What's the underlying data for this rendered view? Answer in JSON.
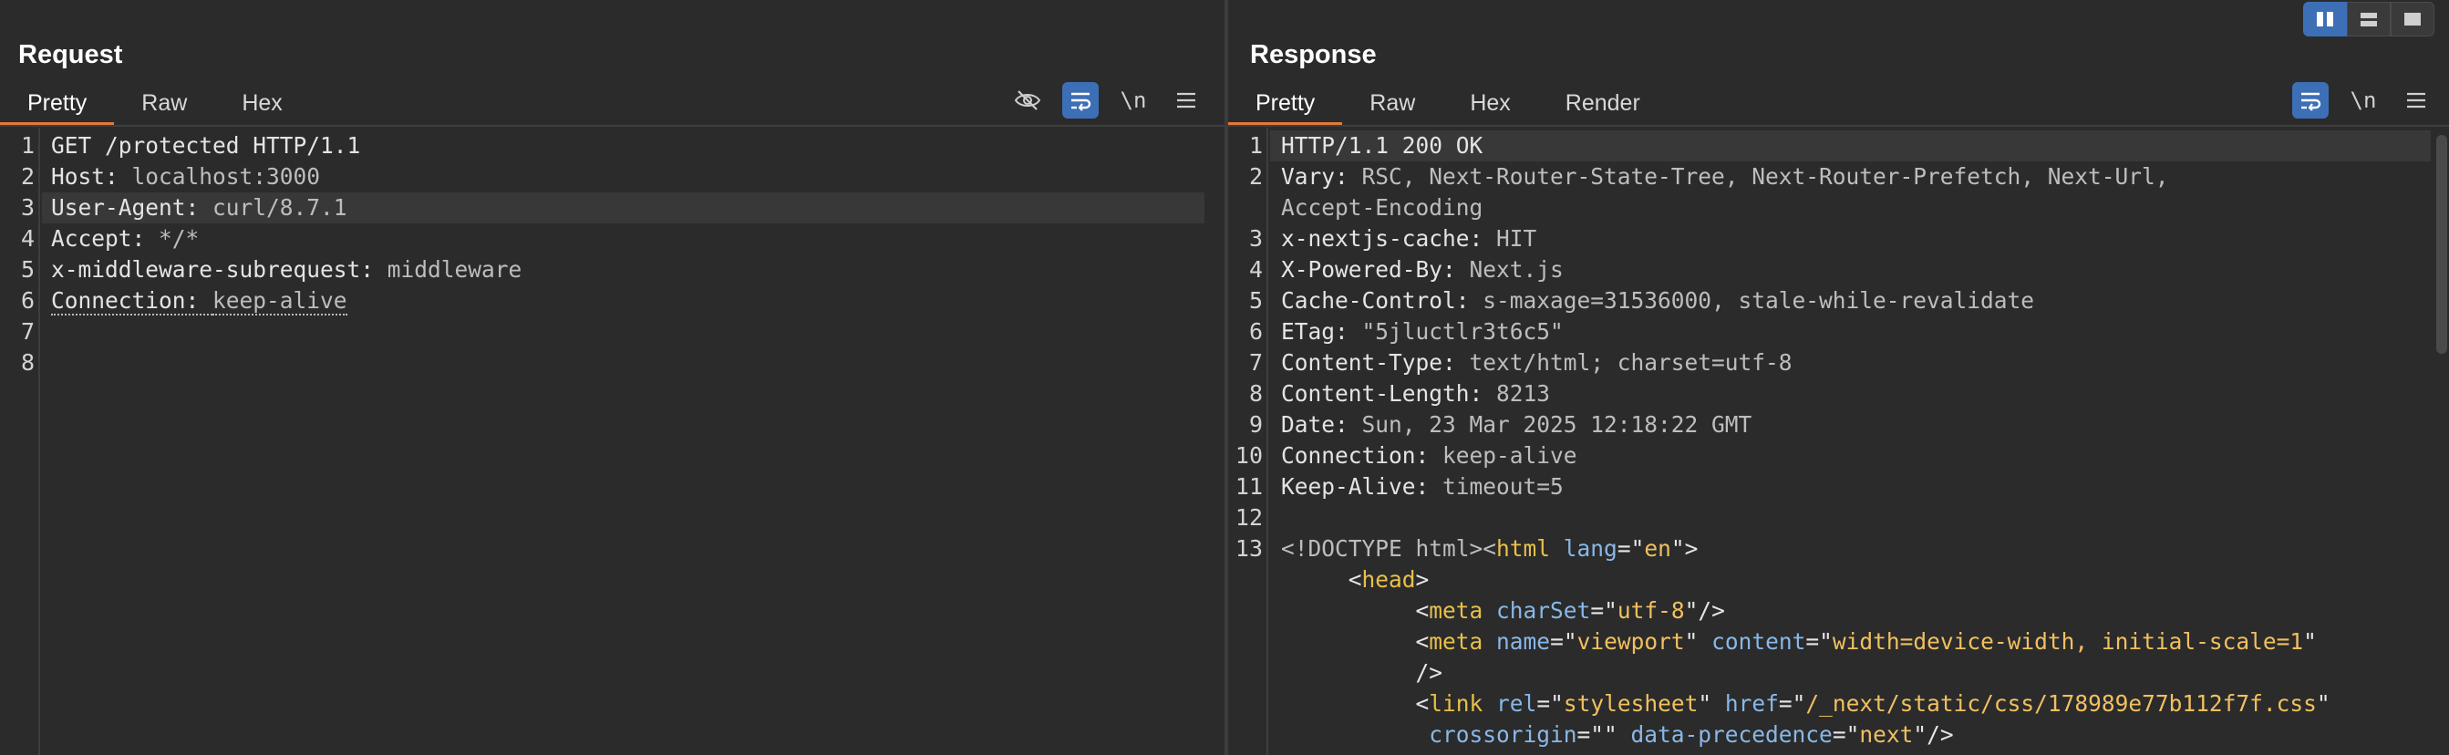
{
  "request": {
    "title": "Request",
    "tabs": [
      "Pretty",
      "Raw",
      "Hex"
    ],
    "active_tab": "Pretty",
    "newline_label": "\\n",
    "lines": [
      {
        "n": "1",
        "parts": [
          {
            "t": "GET /protected HTTP/1.1",
            "c": "k"
          }
        ]
      },
      {
        "n": "2",
        "parts": [
          {
            "t": "Host: ",
            "c": "k"
          },
          {
            "t": "localhost:3000",
            "c": "v"
          }
        ]
      },
      {
        "n": "3",
        "parts": [
          {
            "t": "User-Agent: ",
            "c": "k"
          },
          {
            "t": "curl/8.7.1",
            "c": "v"
          }
        ]
      },
      {
        "n": "4",
        "parts": [
          {
            "t": "Accept: ",
            "c": "k"
          },
          {
            "t": "*/*",
            "c": "v"
          }
        ]
      },
      {
        "n": "5",
        "parts": [
          {
            "t": "x-middleware-subrequest: ",
            "c": "k"
          },
          {
            "t": "middleware",
            "c": "v"
          }
        ]
      },
      {
        "n": "6",
        "parts": [
          {
            "t": "Connection: ",
            "c": "k underline"
          },
          {
            "t": "keep-alive",
            "c": "v underline"
          }
        ]
      },
      {
        "n": "7",
        "parts": []
      },
      {
        "n": "8",
        "parts": []
      }
    ]
  },
  "response": {
    "title": "Response",
    "tabs": [
      "Pretty",
      "Raw",
      "Hex",
      "Render"
    ],
    "active_tab": "Pretty",
    "newline_label": "\\n",
    "lines": [
      {
        "n": "1",
        "parts": [
          {
            "t": "HTTP/1.1 200 OK",
            "c": "k"
          }
        ]
      },
      {
        "n": "2",
        "parts": [
          {
            "t": "Vary: ",
            "c": "k"
          },
          {
            "t": "RSC, Next-Router-State-Tree, Next-Router-Prefetch, Next-Url,",
            "c": "v"
          }
        ]
      },
      {
        "n": "",
        "parts": [
          {
            "t": "Accept-Encoding",
            "c": "v"
          }
        ]
      },
      {
        "n": "3",
        "parts": [
          {
            "t": "x-nextjs-cache: ",
            "c": "k"
          },
          {
            "t": "HIT",
            "c": "v"
          }
        ]
      },
      {
        "n": "4",
        "parts": [
          {
            "t": "X-Powered-By: ",
            "c": "k"
          },
          {
            "t": "Next.js",
            "c": "v"
          }
        ]
      },
      {
        "n": "5",
        "parts": [
          {
            "t": "Cache-Control: ",
            "c": "k"
          },
          {
            "t": "s-maxage=31536000, stale-while-revalidate",
            "c": "v"
          }
        ]
      },
      {
        "n": "6",
        "parts": [
          {
            "t": "ETag: ",
            "c": "k"
          },
          {
            "t": "\"5jluctlr3t6c5\"",
            "c": "v"
          }
        ]
      },
      {
        "n": "7",
        "parts": [
          {
            "t": "Content-Type: ",
            "c": "k"
          },
          {
            "t": "text/html; charset=utf-8",
            "c": "v"
          }
        ]
      },
      {
        "n": "8",
        "parts": [
          {
            "t": "Content-Length: ",
            "c": "k"
          },
          {
            "t": "8213",
            "c": "v"
          }
        ]
      },
      {
        "n": "9",
        "parts": [
          {
            "t": "Date: ",
            "c": "k"
          },
          {
            "t": "Sun, 23 Mar 2025 12:18:22 GMT",
            "c": "v"
          }
        ]
      },
      {
        "n": "10",
        "parts": [
          {
            "t": "Connection: ",
            "c": "k"
          },
          {
            "t": "keep-alive",
            "c": "v"
          }
        ]
      },
      {
        "n": "11",
        "parts": [
          {
            "t": "Keep-Alive: ",
            "c": "k"
          },
          {
            "t": "timeout=5",
            "c": "v"
          }
        ]
      },
      {
        "n": "12",
        "parts": []
      },
      {
        "n": "13",
        "parts": [
          {
            "t": "<!DOCTYPE html><",
            "c": "v"
          },
          {
            "t": "html",
            "c": "tag"
          },
          {
            "t": " ",
            "c": "v"
          },
          {
            "t": "lang",
            "c": "attr"
          },
          {
            "t": "=\"",
            "c": "pun"
          },
          {
            "t": "en",
            "c": "str"
          },
          {
            "t": "\">",
            "c": "pun"
          }
        ]
      },
      {
        "n": "",
        "parts": [
          {
            "t": "     <",
            "c": "pun"
          },
          {
            "t": "head",
            "c": "tag"
          },
          {
            "t": ">",
            "c": "pun"
          }
        ]
      },
      {
        "n": "",
        "parts": [
          {
            "t": "          <",
            "c": "pun"
          },
          {
            "t": "meta",
            "c": "tag"
          },
          {
            "t": " ",
            "c": "v"
          },
          {
            "t": "charSet",
            "c": "attr"
          },
          {
            "t": "=\"",
            "c": "pun"
          },
          {
            "t": "utf-8",
            "c": "str"
          },
          {
            "t": "\"/>",
            "c": "pun"
          }
        ]
      },
      {
        "n": "",
        "parts": [
          {
            "t": "          <",
            "c": "pun"
          },
          {
            "t": "meta",
            "c": "tag"
          },
          {
            "t": " ",
            "c": "v"
          },
          {
            "t": "name",
            "c": "attr"
          },
          {
            "t": "=\"",
            "c": "pun"
          },
          {
            "t": "viewport",
            "c": "str"
          },
          {
            "t": "\" ",
            "c": "pun"
          },
          {
            "t": "content",
            "c": "attr"
          },
          {
            "t": "=\"",
            "c": "pun"
          },
          {
            "t": "width=device-width, initial-scale=1",
            "c": "str"
          },
          {
            "t": "\"",
            "c": "pun"
          }
        ]
      },
      {
        "n": "",
        "parts": [
          {
            "t": "          />",
            "c": "pun"
          }
        ]
      },
      {
        "n": "",
        "parts": [
          {
            "t": "          <",
            "c": "pun"
          },
          {
            "t": "link",
            "c": "tag"
          },
          {
            "t": " ",
            "c": "v"
          },
          {
            "t": "rel",
            "c": "attr"
          },
          {
            "t": "=\"",
            "c": "pun"
          },
          {
            "t": "stylesheet",
            "c": "str"
          },
          {
            "t": "\" ",
            "c": "pun"
          },
          {
            "t": "href",
            "c": "attr"
          },
          {
            "t": "=\"",
            "c": "pun"
          },
          {
            "t": "/_next/static/css/178989e77b112f7f.css",
            "c": "str"
          },
          {
            "t": "\"",
            "c": "pun"
          }
        ]
      },
      {
        "n": "",
        "parts": [
          {
            "t": "           ",
            "c": "v"
          },
          {
            "t": "crossorigin",
            "c": "attr"
          },
          {
            "t": "=\"\" ",
            "c": "pun"
          },
          {
            "t": "data-precedence",
            "c": "attr"
          },
          {
            "t": "=\"",
            "c": "pun"
          },
          {
            "t": "next",
            "c": "str"
          },
          {
            "t": "\"/>",
            "c": "pun"
          }
        ]
      }
    ]
  }
}
